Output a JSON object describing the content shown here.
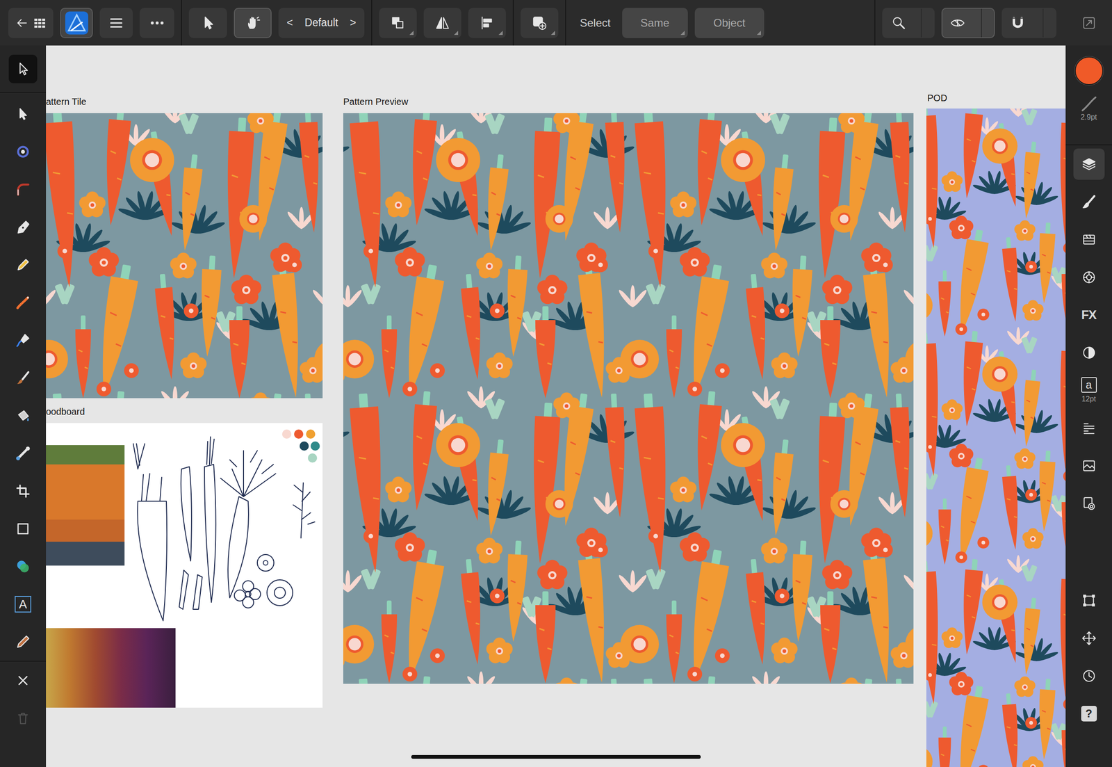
{
  "toolbar": {
    "app_buttons": [
      {
        "selected": false
      },
      {
        "selected": true
      },
      {
        "selected": false
      },
      {
        "selected": false
      }
    ],
    "modes": [
      {
        "selected": false
      },
      {
        "selected": true
      }
    ],
    "style": {
      "prev": "<",
      "label": "Default",
      "next": ">"
    },
    "arrange": [
      {
        "selected": false
      },
      {
        "selected": false
      },
      {
        "selected": false
      }
    ],
    "insert": {
      "selected": false
    },
    "select": {
      "label": "Select",
      "options": [
        "Same",
        "Object"
      ]
    },
    "view": [
      {
        "selected": false
      },
      {
        "selected": true
      },
      {
        "selected": false
      }
    ],
    "fullscreen": {
      "selected": false
    }
  },
  "tools": [
    {
      "selected": true
    },
    {
      "selected": false
    },
    {
      "selected": false
    },
    {
      "selected": false
    },
    {
      "selected": false
    },
    {
      "selected": false
    },
    {
      "selected": false
    },
    {
      "selected": false
    },
    {
      "selected": false
    },
    {
      "selected": false
    },
    {
      "selected": false
    },
    {
      "selected": false
    },
    {
      "selected": false
    },
    {
      "selected": false
    },
    {
      "selected": false,
      "glyph": "A"
    },
    {
      "selected": false
    }
  ],
  "tool_actions": [
    {
      "disabled": false
    },
    {
      "disabled": true
    }
  ],
  "right_panel": {
    "fill_color": "#f05a28",
    "stroke_width": "2.9pt",
    "studios": [
      {
        "selected": true
      },
      {
        "selected": false
      },
      {
        "selected": false
      },
      {
        "selected": false
      },
      {
        "selected": false,
        "glyph": "FX"
      },
      {
        "selected": false
      },
      {
        "selected": false,
        "glyph": "a",
        "caption": "12pt"
      },
      {
        "selected": false
      },
      {
        "selected": false
      },
      {
        "selected": false
      }
    ],
    "utilities": [
      {
        "selected": false
      },
      {
        "selected": false
      },
      {
        "selected": false
      },
      {
        "selected": false,
        "glyph": "?"
      }
    ]
  },
  "artboards": [
    {
      "label": "attern Tile",
      "kind": "tile",
      "color": "#7d98a1"
    },
    {
      "label": "oodboard",
      "kind": "moodboard"
    },
    {
      "label": "Pattern Preview",
      "kind": "preview",
      "color": "#7d98a1"
    },
    {
      "label": "POD",
      "kind": "pod",
      "color": "#a4aee2"
    }
  ],
  "moodboard": {
    "palette": [
      {
        "color": "#f8d8d0"
      },
      {
        "color": "#ee5a2f"
      },
      {
        "color": "#f0a030"
      },
      {
        "color": "#1e4a5d"
      },
      {
        "color": "#2e8a8a"
      },
      {
        "color": "#a8d5c2"
      }
    ]
  }
}
